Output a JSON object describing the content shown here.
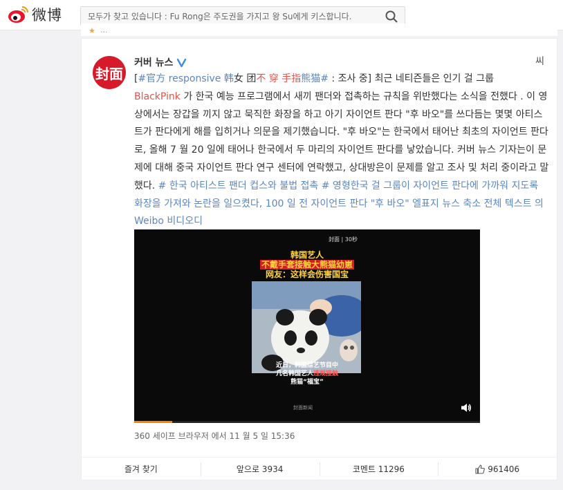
{
  "header": {
    "logo_text": "微博",
    "search_placeholder": "모두가 찾고 있습니다 : Fu Rong은 주도권을 가지고 왕 Su에게 키스합니다."
  },
  "strip": {
    "text": "..."
  },
  "post": {
    "avatar_text": "封面",
    "author": "커버 뉴스",
    "more_label": "씨",
    "text": {
      "p1_open": "[",
      "p1_tag": "#官方 responsive 韩",
      "p1_black1": "女 团",
      "p1_tag2": "不 穿 手指",
      "p1_tag3": "熊猫",
      "p1_hash": "#",
      "p1_rest": " : 조사 중] 최근 네티즌들은 인기 걸 그룹",
      "p2_name": "BlackPink",
      "p2_rest": " 가 한국 예능 프로그램에서 새끼 팬더와 접촉하는 규칙을 위반했다는 소식을 전했다 . 이 영상에서는 장갑을 끼지 않고 묵직한 화장을 하고 아기 자이언트 판다 \"후 바오\"를 쓰다듬는 몇몇 아티스트가 판다에게 해를 입히거나 의문을 제기했습니다. \"후 바오\"는 한국에서 태어난 최초의 자이언트 판다로, 올해 7 월 20 일에 태어나 한국에서 두 마리의 자이언트 판다를 낳았습니다. 커버 뉴스 기자는이 문제에 대해 중국 자이언트 판다 연구 센터에 연락했고, 상대방은이 문제를 알고 조사 및 처리 중이라고 말했다. ",
      "link1": "# 한국 아티스트 팬더 컵스와 불법 접촉 #",
      "link2": " 영형한국 걸 그룹이 자이언트 판다에 가까워 지도록 화장을 가져와 논란을 일으켰다, 100 일 전 자이언트 판다 \"후 바오\" 엘표지 뉴스 축소 전체 텍스트 의 Weibo 비디오디"
    },
    "video": {
      "brand": "封面 | 30秒",
      "title_line1": "韩国艺人",
      "title_line2": "不戴手套接触大熊猫幼崽",
      "title_line3": "网友：这样会伤害国宝",
      "sub_line1": "近日，韩国综艺节目中",
      "sub_line2_a": "几名韩国艺人",
      "sub_line2_b": "违规接触",
      "sub_line3": "熊猫“福宝”",
      "source": "封面新闻",
      "progress": 0.11
    },
    "meta": "360 세이프 브라우저  에서 11 월 5 일 15:36"
  },
  "actions": {
    "favorite": "즐겨 찾기",
    "forward": "앞으로 3934",
    "comment": "코멘트 11296",
    "like": "961406"
  },
  "colors": {
    "accent": "#ff8200",
    "link": "#5b86bf",
    "highlight": "#e4534b",
    "brand_red": "#d61a2a"
  }
}
